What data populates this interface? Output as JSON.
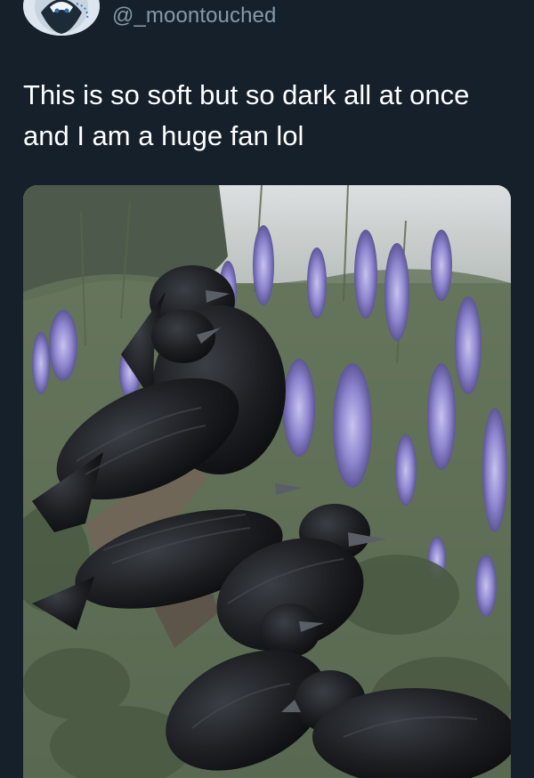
{
  "tweet": {
    "handle": "@_moontouched",
    "text": "This is so soft but so dark all at once and I am a huge fan lol"
  },
  "media": {
    "subject": "ravens-among-lupine-flowers"
  },
  "colors": {
    "background": "#15202b",
    "handle": "#8899a6",
    "text": "#ffffff"
  }
}
